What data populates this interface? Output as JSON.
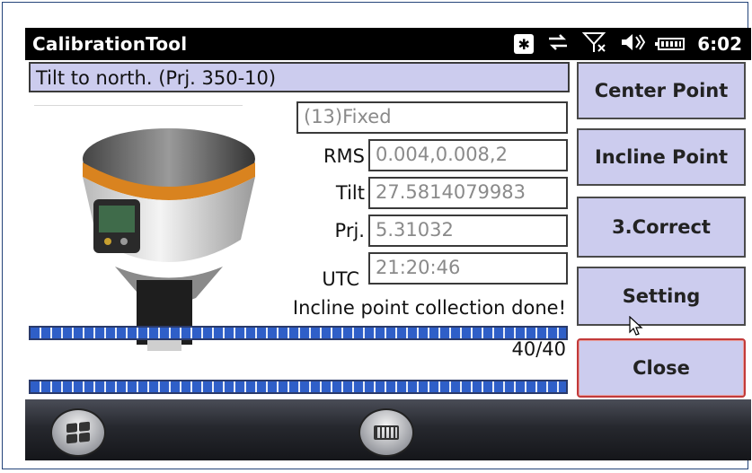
{
  "titlebar": {
    "app_title": "CalibrationTool",
    "icons": [
      "bluetooth-icon",
      "sync-arrows-icon",
      "no-signal-icon",
      "volume-icon",
      "battery-icon"
    ],
    "bluetooth_glyph": "✱",
    "time": "6:02"
  },
  "main": {
    "title_text": "Tilt to north. (Prj. 350-10)",
    "solution_status": "(13)Fixed",
    "fields": {
      "rms_label": "RMS",
      "rms_value": "0.004,0.008,2",
      "tilt_label": "Tilt",
      "tilt_value": "27.5814079983",
      "prj_label": "Prj.",
      "prj_value": "5.31032",
      "utc_label": "UTC",
      "utc_value": "21:20:46"
    },
    "status_message": "Incline point collection done!",
    "progress_1": 1.0,
    "progress_2": 1.0,
    "progress_count": "40/40"
  },
  "buttons": {
    "center_point": "Center Point",
    "incline_point": "Incline Point",
    "correct": "3.Correct",
    "setting": "Setting",
    "close": "Close"
  },
  "taskbar": {
    "start_icon": "windows-start-icon",
    "keyboard_icon": "keyboard-icon"
  },
  "colors": {
    "button_fill": "#ccccee",
    "progress_fill": "#2f5fc8",
    "close_border": "#c23a3a",
    "titlebar_bg": "#000000"
  }
}
